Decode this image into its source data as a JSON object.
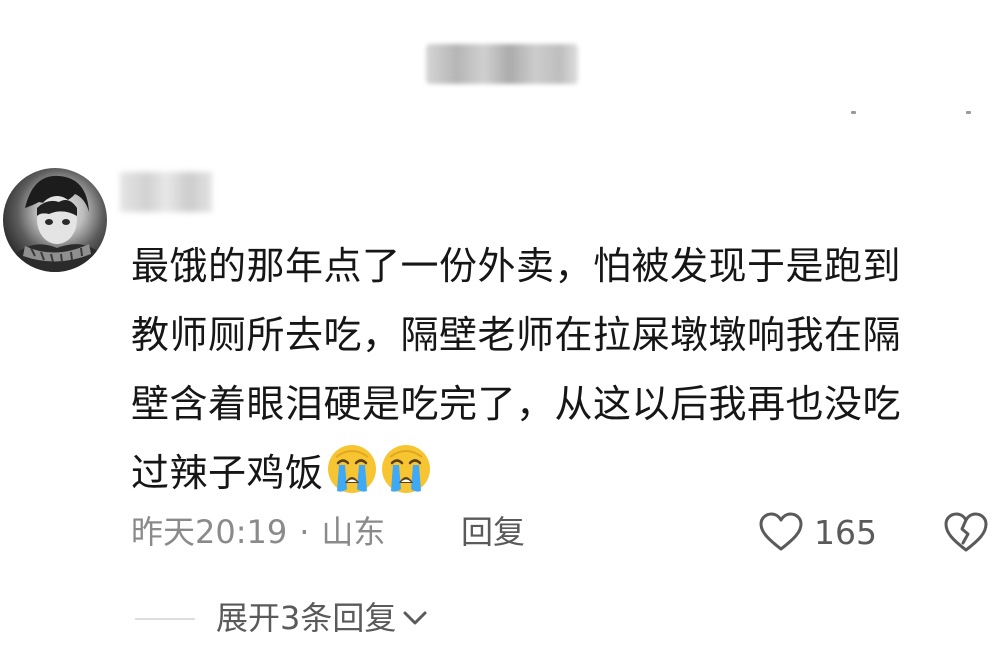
{
  "comment": {
    "text": "最饿的那年点了一份外卖，怕被发现于是跑到\n教师厕所去吃，隔壁老师在拉屎墩墩响我在隔\n壁含着眼泪硬是吃完了，从这以后我再也没吃\n过辣子鸡饭",
    "emojis": [
      "crying-face-emoji",
      "crying-face-emoji"
    ],
    "time": "昨天20:19",
    "separator": "·",
    "location": "山东",
    "reply_label": "回复",
    "like_count": "165"
  },
  "replies": {
    "expand_label": "展开3条回复"
  },
  "icons": {
    "like": "heart-outline-icon",
    "dislike": "broken-heart-icon",
    "expand": "chevron-down-icon"
  },
  "colors": {
    "text": "#161616",
    "meta": "#8a8a8a",
    "action": "#5a5a5a",
    "emoji_face": "#f7c531",
    "emoji_tears": "#3fa9f5"
  }
}
